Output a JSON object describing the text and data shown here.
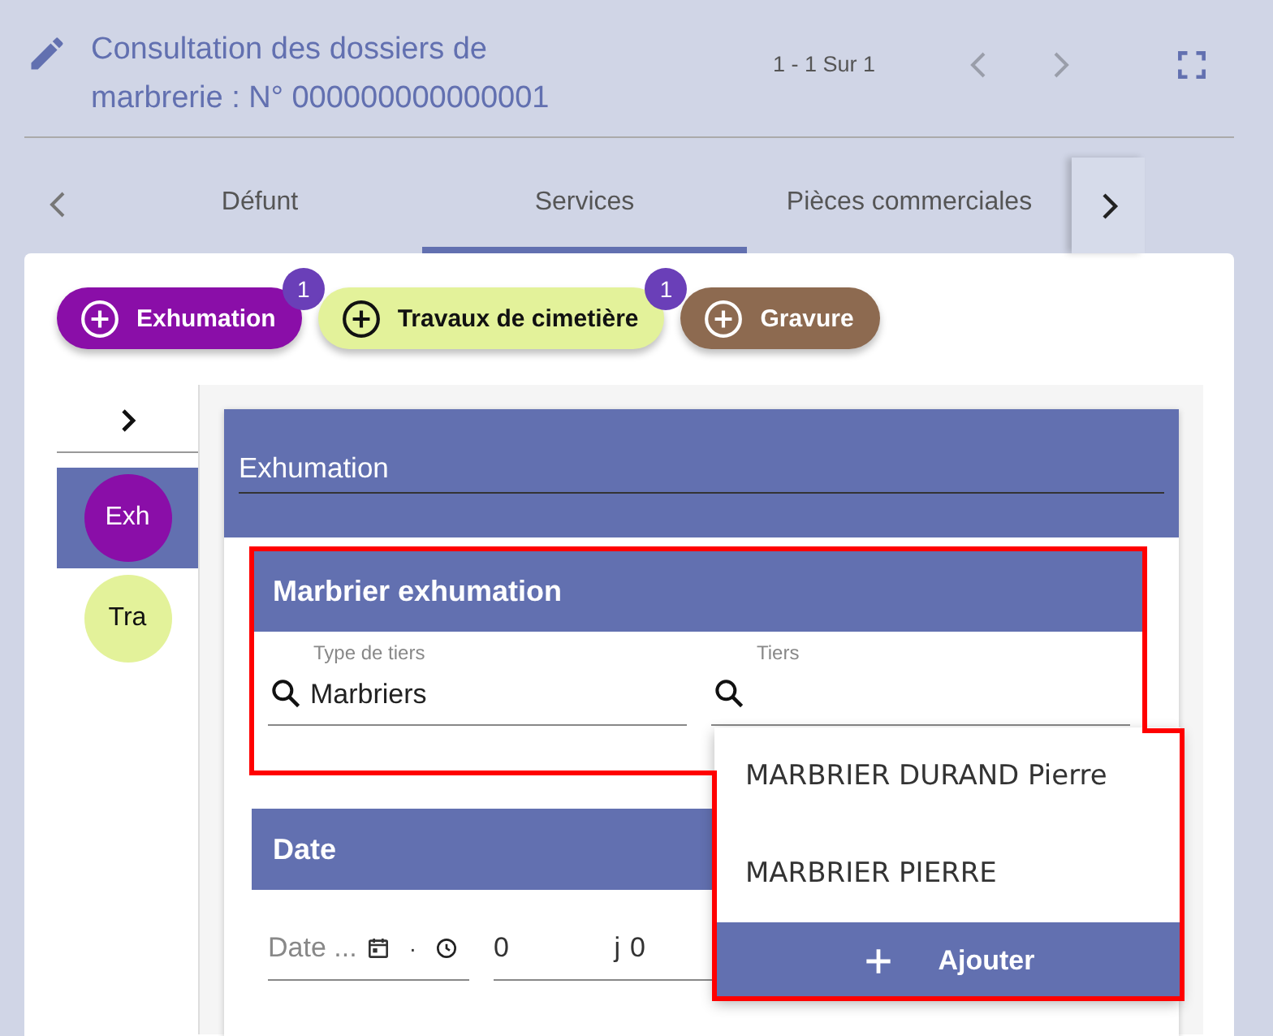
{
  "header": {
    "title": "Consultation des dossiers de marbrerie : N° 000000000000001",
    "pager": "1 - 1 Sur 1"
  },
  "tabs": [
    {
      "label": "Défunt",
      "selected": false
    },
    {
      "label": "Services",
      "selected": true
    },
    {
      "label": "Pièces commerciales",
      "selected": false
    }
  ],
  "service_chips": [
    {
      "label": "Exhumation",
      "color": "#8a0ea8",
      "count": "1"
    },
    {
      "label": "Travaux de cimetière",
      "color": "#e3f29a",
      "count": "1"
    },
    {
      "label": "Gravure",
      "color": "#8d6a50"
    }
  ],
  "side_items": [
    {
      "label": "Exh",
      "color": "#8a0ea8",
      "selected": true
    },
    {
      "label": "Tra",
      "color": "#e3f29a",
      "selected": false
    }
  ],
  "panel": {
    "title": "Exhumation",
    "marbrier_section": {
      "title": "Marbrier exhumation",
      "fields": [
        {
          "label": "Type de tiers",
          "value": "Marbriers"
        },
        {
          "label": "Tiers"
        }
      ]
    },
    "date_section": {
      "title": "Date",
      "date_placeholder": "Date ...",
      "separator": "·",
      "days_value": "0",
      "days_unit": "j",
      "hours_value": "0"
    }
  },
  "dropdown": {
    "options": [
      "MARBRIER DURAND Pierre",
      "MARBRIER PIERRE"
    ],
    "add_label": "Ajouter"
  }
}
